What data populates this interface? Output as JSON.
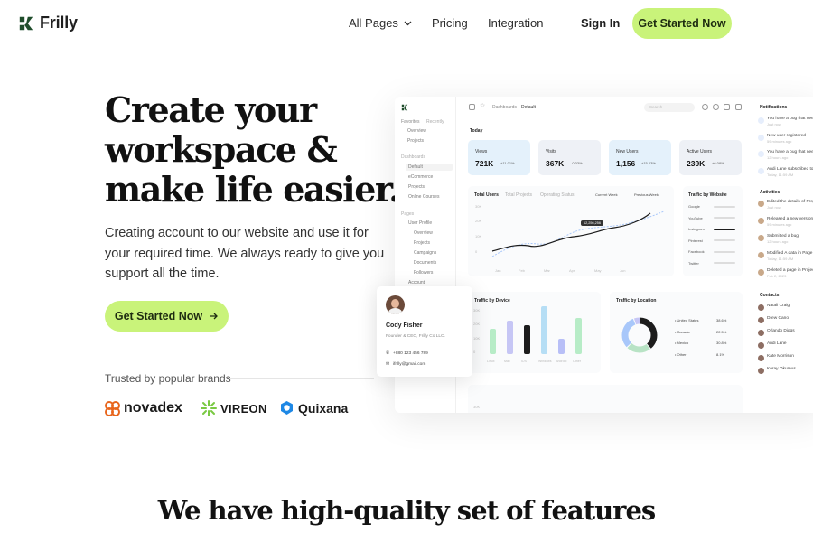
{
  "nav": {
    "brand": "Frilly",
    "links": [
      "All Pages",
      "Pricing",
      "Integration"
    ],
    "signin": "Sign In",
    "cta": "Get Started Now"
  },
  "hero": {
    "title": "Create your workspace & make life easier.",
    "text": "Creating account to our website and use it for your required time. We always ready to give you support all the time.",
    "cta": "Get Started Now",
    "trusted": "Trusted by popular brands",
    "brands": [
      "novadex",
      "VIREON",
      "Quixana"
    ]
  },
  "dashboard": {
    "sidebar": {
      "favorites": "Favorites",
      "recently": "Recently",
      "fav_items": [
        "Overview",
        "Projects"
      ],
      "dashboards": "Dashboards",
      "dash_items": [
        "Default",
        "eCommerce",
        "Projects",
        "Online Courses"
      ],
      "pages": "Pages",
      "page_items": [
        "User Profile",
        "Overview",
        "Projects",
        "Campaigns",
        "Documents",
        "Followers",
        "Account"
      ]
    },
    "breadcrumb": [
      "Dashboards",
      "Default"
    ],
    "search_placeholder": "Search",
    "today": "Today",
    "kpis": [
      {
        "label": "Views",
        "value": "721K",
        "change": "+11.01%",
        "color": "#e4f1fb"
      },
      {
        "label": "Visits",
        "value": "367K",
        "change": "-0.03%",
        "color": "#eef1f6"
      },
      {
        "label": "New Users",
        "value": "1,156",
        "change": "+15.03%",
        "color": "#e4f1fb"
      },
      {
        "label": "Active Users",
        "value": "239K",
        "change": "+6.08%",
        "color": "#eef1f6"
      }
    ],
    "chart_tabs": [
      "Total Users",
      "Total Projects",
      "Operating Status"
    ],
    "chart_legend": [
      "Current Week",
      "Previous Week"
    ],
    "chart_tooltip": "12,256,256",
    "line_yticks": [
      "30K",
      "20K",
      "10K",
      "0"
    ],
    "line_xticks": [
      "Jan",
      "Feb",
      "Mar",
      "Apr",
      "May",
      "Jun"
    ],
    "traffic_site_title": "Traffic by Website",
    "sites": [
      "Google",
      "YouTube",
      "Instagram",
      "Pinterest",
      "Facebook",
      "Twitter"
    ],
    "traffic_device_title": "Traffic by Device",
    "device_yticks": [
      "30K",
      "20K",
      "10K",
      "0"
    ],
    "devices": [
      "Linux",
      "Mac",
      "iOS",
      "Windows",
      "Android",
      "Other"
    ],
    "device_values": [
      17,
      22,
      19,
      32,
      10,
      24
    ],
    "device_colors": [
      "#b7ecc7",
      "#c6c6f5",
      "#1c1c1c",
      "#b6def5",
      "#b8bff7",
      "#b7ecc7"
    ],
    "traffic_loc_title": "Traffic by Location",
    "locations": [
      {
        "name": "United States",
        "pct": "38.6%"
      },
      {
        "name": "Canada",
        "pct": "22.5%"
      },
      {
        "name": "Mexico",
        "pct": "30.8%"
      },
      {
        "name": "Other",
        "pct": "8.1%"
      }
    ],
    "bottom_ytick": "30K",
    "notifications_title": "Notifications",
    "notifications": [
      {
        "text": "You have a bug that needs...",
        "time": "Just now"
      },
      {
        "text": "New user registered",
        "time": "59 minutes ago"
      },
      {
        "text": "You have a bug that needs...",
        "time": "12 hours ago"
      },
      {
        "text": "Andi Lane subscribed to you",
        "time": "Today, 11:59 AM"
      }
    ],
    "activities_title": "Activities",
    "activities": [
      {
        "text": "Edited the details of Project X",
        "time": "Just now"
      },
      {
        "text": "Released a new version",
        "time": "59 minutes ago"
      },
      {
        "text": "Submitted a bug",
        "time": "12 hours ago"
      },
      {
        "text": "Modified A data in Page X",
        "time": "Today, 11:59 AM"
      },
      {
        "text": "Deleted a page in Project X",
        "time": "Feb 2, 2023"
      }
    ],
    "contacts_title": "Contacts",
    "contacts": [
      "Natali Craig",
      "Drew Cano",
      "Orlando Diggs",
      "Andi Lane",
      "Kate Morrison",
      "Koray Okumus"
    ]
  },
  "profile": {
    "name": "Cody Fisher",
    "role": "Founder & CEO, Frilly Co LLC.",
    "phone": "+880 123 456 789",
    "email": "ifrilly@gmail.com"
  },
  "features": {
    "title": "We have high-quality set of features"
  },
  "colors": {
    "accent": "#c9f37a",
    "brand_green": "#1f4d2b",
    "novadex_orange": "#e8651c",
    "vireon_green": "#7ac943",
    "quixana_blue": "#1e88e5"
  }
}
